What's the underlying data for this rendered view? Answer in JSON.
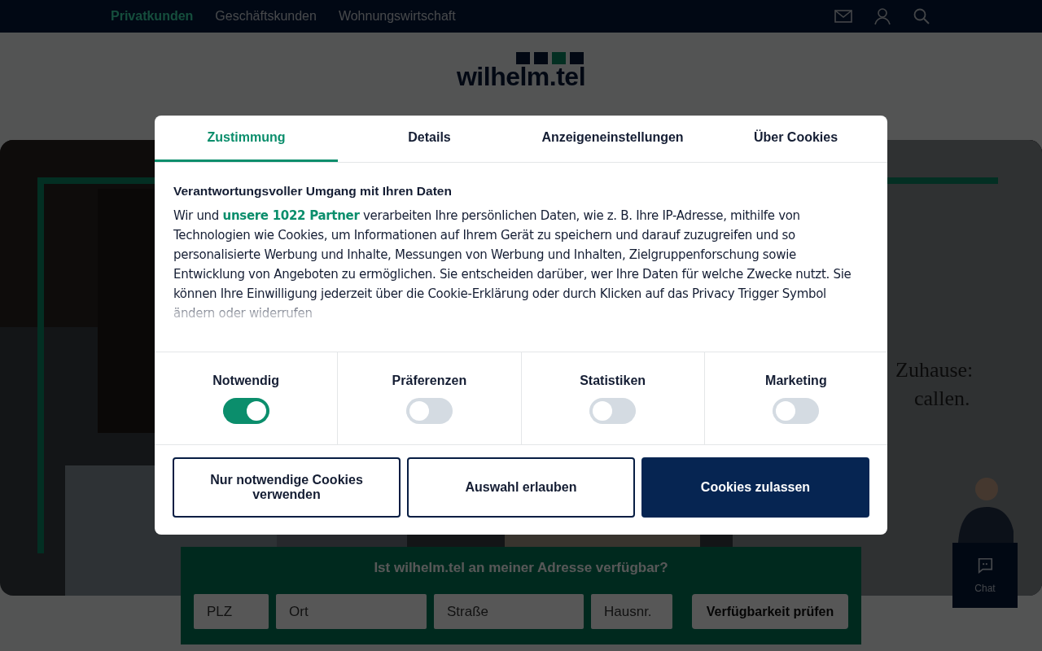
{
  "top_nav": {
    "links": [
      {
        "label": "Privatkunden",
        "selected": true
      },
      {
        "label": "Geschäftskunden",
        "selected": false
      },
      {
        "label": "Wohnungswirtschaft",
        "selected": false
      }
    ]
  },
  "logo": {
    "text": "wilhelm.tel"
  },
  "hero": {
    "kind": "picture",
    "headline": [
      "Zuhause:",
      "callen."
    ]
  },
  "availability": {
    "title": "Ist wilhelm.tel an meiner Adresse verfügbar?",
    "fields": [
      {
        "placeholder": "PLZ"
      },
      {
        "placeholder": "Ort"
      },
      {
        "placeholder": "Straße"
      },
      {
        "placeholder": "Hausnr."
      }
    ],
    "button": "Verfügbarkeit prüfen"
  },
  "chat": {
    "label": "Chat"
  },
  "consent_dialog": {
    "tabs": [
      {
        "label": "Zustimmung",
        "selected": true
      },
      {
        "label": "Details",
        "selected": false
      },
      {
        "label": "Anzeigeneinstellungen",
        "selected": false
      },
      {
        "label": "Über Cookies",
        "selected": false
      }
    ],
    "heading": "Verantwortungsvoller Umgang mit Ihren Daten",
    "text_before": "Wir und",
    "link": "unsere 1022 Partner",
    "text_after": "verarbeiten Ihre persönlichen Daten, wie z. B. Ihre IP-Adresse, mithilfe von Technologien wie Cookies, um Informationen auf Ihrem Gerät zu speichern und darauf zuzugreifen und so personalisierte Werbung und Inhalte, Messungen von Werbung und Inhalten, Zielgruppenforschung sowie Entwicklung von Angeboten zu ermöglichen. Sie entscheiden darüber, wer Ihre Daten für welche Zwecke nutzt. Sie können Ihre Einwilligung jederzeit über die Cookie-Erklärung oder durch Klicken auf das Privacy Trigger Symbol ändern oder widerrufen",
    "categories": [
      {
        "label": "Notwendig",
        "on": true
      },
      {
        "label": "Präferenzen",
        "on": false
      },
      {
        "label": "Statistiken",
        "on": false
      },
      {
        "label": "Marketing",
        "on": false
      }
    ],
    "buttons": [
      {
        "label": "Nur notwendige Cookies verwenden",
        "kind": "outline"
      },
      {
        "label": "Auswahl erlauben",
        "kind": "outline"
      },
      {
        "label": "Cookies zulassen",
        "kind": "primary"
      }
    ]
  }
}
